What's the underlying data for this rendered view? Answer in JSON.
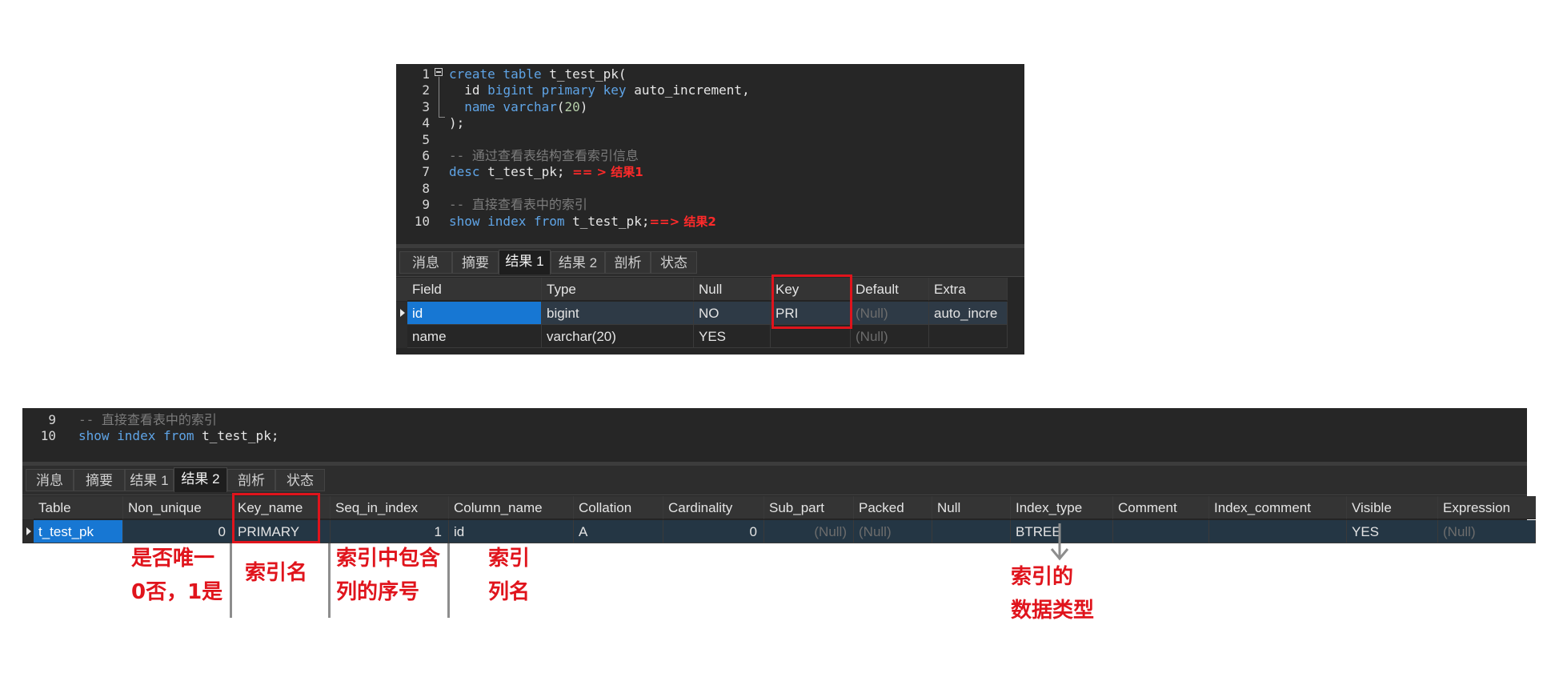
{
  "panel1": {
    "code": [
      {
        "n": "1",
        "parts": [
          [
            "kw",
            "create table "
          ],
          [
            "txt",
            "t_test_pk("
          ]
        ]
      },
      {
        "n": "2",
        "parts": [
          [
            "txt",
            "  id "
          ],
          [
            "kw",
            "bigint primary key "
          ],
          [
            "txt",
            "auto_increment,"
          ]
        ]
      },
      {
        "n": "3",
        "parts": [
          [
            "txt",
            "  "
          ],
          [
            "kw",
            "name varchar"
          ],
          [
            "txt",
            "("
          ],
          [
            "num",
            "20"
          ],
          [
            "txt",
            ")"
          ]
        ]
      },
      {
        "n": "4",
        "parts": [
          [
            "txt",
            ");"
          ]
        ]
      },
      {
        "n": "5",
        "parts": []
      },
      {
        "n": "6",
        "parts": [
          [
            "cm",
            "-- 通过查看表结构查看索引信息"
          ]
        ]
      },
      {
        "n": "7",
        "parts": [
          [
            "kw",
            "desc "
          ],
          [
            "txt",
            "t_test_pk; "
          ],
          [
            "ann",
            "== > 结果1"
          ]
        ]
      },
      {
        "n": "8",
        "parts": []
      },
      {
        "n": "9",
        "parts": [
          [
            "cm",
            "-- 直接查看表中的索引"
          ]
        ]
      },
      {
        "n": "10",
        "parts": [
          [
            "kw",
            "show index from "
          ],
          [
            "txt",
            "t_test_pk;"
          ],
          [
            "ann",
            "==> 结果2"
          ]
        ]
      }
    ],
    "tabs": [
      "消息",
      "摘要",
      "结果 1",
      "结果 2",
      "剖析",
      "状态"
    ],
    "active_tab": 2,
    "columns": [
      "Field",
      "Type",
      "Null",
      "Key",
      "Default",
      "Extra"
    ],
    "rows": [
      [
        "id",
        "bigint",
        "NO",
        "PRI",
        "(Null)",
        "auto_incre"
      ],
      [
        "name",
        "varchar(20)",
        "YES",
        "",
        "(Null)",
        ""
      ]
    ]
  },
  "panel2": {
    "code": [
      {
        "n": "9",
        "parts": [
          [
            "cm",
            "-- 直接查看表中的索引"
          ]
        ]
      },
      {
        "n": "10",
        "parts": [
          [
            "kw",
            "show index from "
          ],
          [
            "txt",
            "t_test_pk;"
          ]
        ]
      }
    ],
    "tabs": [
      "消息",
      "摘要",
      "结果 1",
      "结果 2",
      "剖析",
      "状态"
    ],
    "active_tab": 3,
    "columns": [
      "Table",
      "Non_unique",
      "Key_name",
      "Seq_in_index",
      "Column_name",
      "Collation",
      "Cardinality",
      "Sub_part",
      "Packed",
      "Null",
      "Index_type",
      "Comment",
      "Index_comment",
      "Visible",
      "Expression"
    ],
    "rows": [
      [
        "t_test_pk",
        "0",
        "PRIMARY",
        "1",
        "id",
        "A",
        "0",
        "(Null)",
        "(Null)",
        "",
        "BTREE",
        "",
        "",
        "YES",
        "(Null)"
      ]
    ]
  },
  "annotations": {
    "non_unique_line1": "是否唯一",
    "non_unique_line2": "0否，1是",
    "key_name": "索引名",
    "seq_line1": "索引中包含",
    "seq_line2": "列的序号",
    "col_line1": "索引",
    "col_line2": "列名",
    "type_line1": "索引的",
    "type_line2": "数据类型"
  },
  "colors": {
    "editor_bg": "#262626",
    "keyword": "#5fa4e6",
    "comment": "#7c7c7c",
    "annotation_red": "#e0141c",
    "selection": "#1777d3"
  }
}
